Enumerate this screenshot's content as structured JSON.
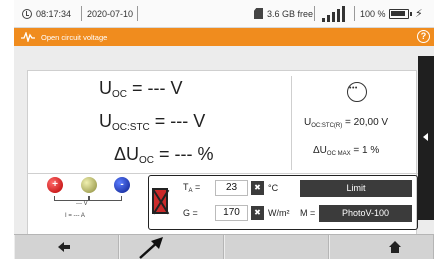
{
  "status": {
    "time": "08:17:34",
    "date": "2020-07-10",
    "storage": "3.6 GB free",
    "battery_pct": "100 %",
    "charging_symbol": "⚡"
  },
  "header": {
    "title": "Open circuit voltage",
    "help_symbol": "?"
  },
  "measurements": {
    "uoc": {
      "main": "U",
      "sub": "OC",
      "value": " = --- V"
    },
    "uoc_stc": {
      "main": "U",
      "sub": "OC:STC",
      "value": " = --- V"
    },
    "delta_uoc": {
      "main": "ΔU",
      "sub": "OC",
      "value": " = --- %"
    }
  },
  "limits": {
    "uoc_stc_r": {
      "main": "U",
      "sub": "OC:STC(R)",
      "value": " = 20,00 V"
    },
    "delta_uoc_max": {
      "main": "ΔU",
      "sub": "OC MAX",
      "value": " = 1 %"
    }
  },
  "probes": {
    "plus": "+",
    "minus": "-",
    "v_label": "--- V",
    "i_label": "I = --- A"
  },
  "conditions": {
    "ta_label_main": "T",
    "ta_label_sub": "A",
    "ta_label_eq": " =",
    "ta_value": "23",
    "ta_unit": "°C",
    "g_label": "G =",
    "g_value": "170",
    "g_unit": "W/m²",
    "clear_symbol": "✖",
    "limit_button": "Limit",
    "module_label": "M =",
    "module_value": "PhotoV-100"
  }
}
